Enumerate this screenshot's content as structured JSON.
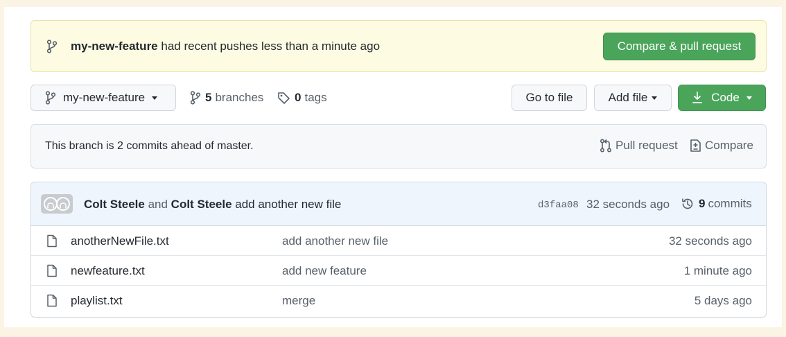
{
  "banner": {
    "branch": "my-new-feature",
    "message": " had recent pushes less than a minute ago",
    "compare_label": "Compare & pull request"
  },
  "toolbar": {
    "branch_select": "my-new-feature",
    "branches_count": "5",
    "branches_label": "branches",
    "tags_count": "0",
    "tags_label": "tags",
    "go_to_file": "Go to file",
    "add_file": "Add file",
    "code": "Code"
  },
  "ahead": {
    "text": "This branch is 2 commits ahead of master.",
    "pull_request": "Pull request",
    "compare": "Compare"
  },
  "latest_commit": {
    "author1": "Colt Steele",
    "joiner": " and ",
    "author2": "Colt Steele",
    "message": " add another new file",
    "sha": "d3faa08",
    "age": "32 seconds ago",
    "commits_count": "9",
    "commits_label": "commits"
  },
  "files": [
    {
      "name": "anotherNewFile.txt",
      "message": "add another new file",
      "age": "32 seconds ago"
    },
    {
      "name": "newfeature.txt",
      "message": "add new feature",
      "age": "1 minute ago"
    },
    {
      "name": "playlist.txt",
      "message": "merge",
      "age": "5 days ago"
    }
  ],
  "colors": {
    "accent_green": "#4aa55a",
    "banner_bg": "#fdfbe2",
    "commit_bg": "#eef5fd",
    "page_bg": "#fbf3e3"
  },
  "icons": [
    "git-branch-icon",
    "tag-icon",
    "download-icon",
    "pull-request-icon",
    "diff-icon",
    "history-icon",
    "file-icon"
  ]
}
